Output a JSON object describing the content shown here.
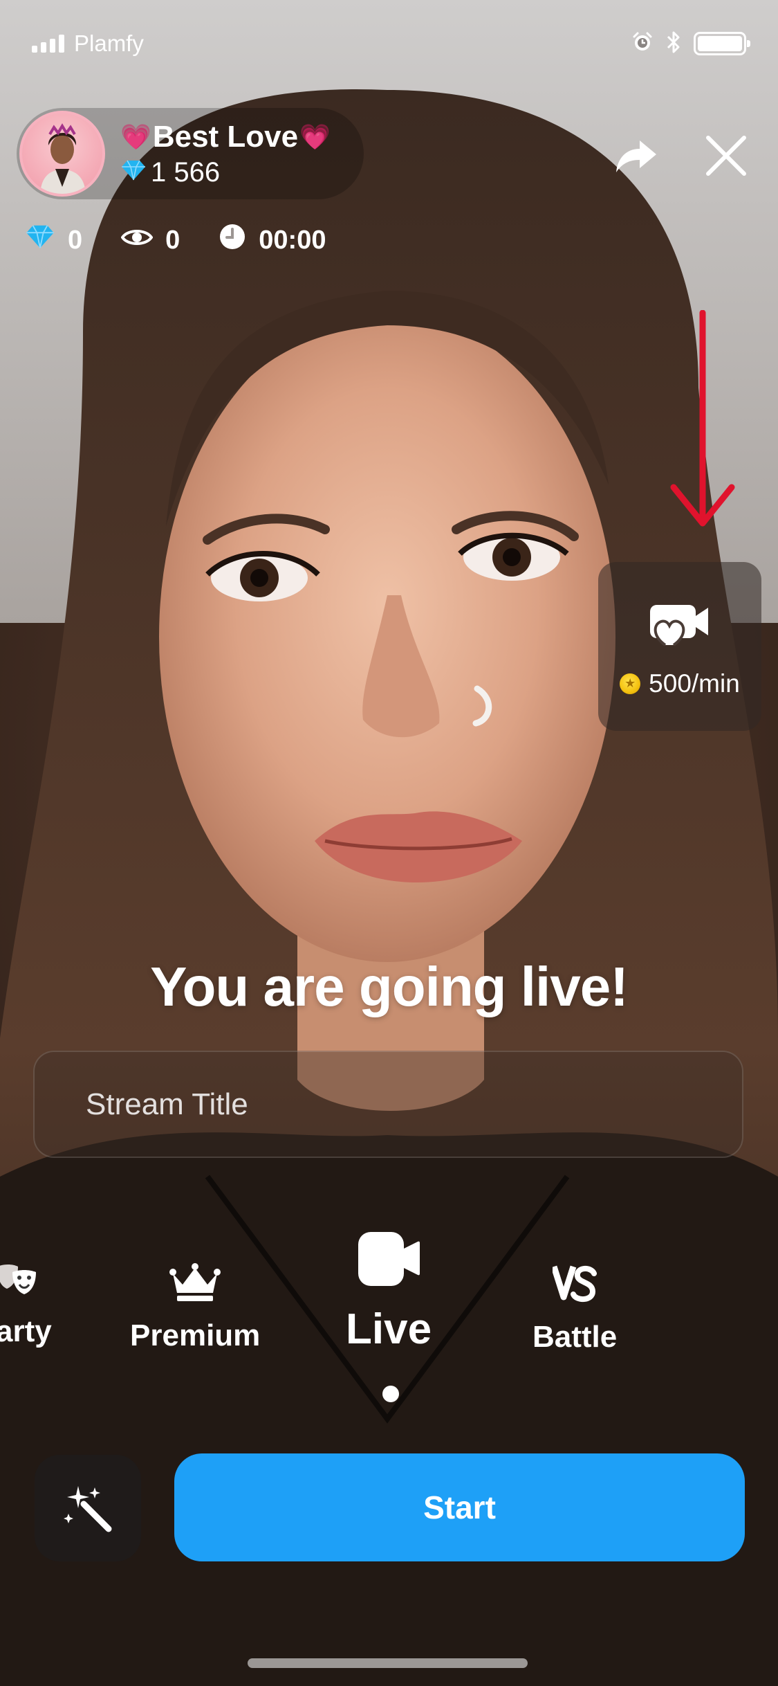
{
  "status_bar": {
    "carrier": "Plamfy",
    "icons": [
      "signal-icon",
      "alarm-icon",
      "bluetooth-icon",
      "battery-icon"
    ]
  },
  "host": {
    "name": "Best Love",
    "name_emoji": "💗",
    "diamonds": "1 566"
  },
  "stats": {
    "diamonds": "0",
    "viewers": "0",
    "duration": "00:00"
  },
  "video_card": {
    "price": "500/min",
    "icon": "video-call-icon"
  },
  "headline": "You are going live!",
  "stream_title": {
    "placeholder": "Stream Title",
    "value": ""
  },
  "modes": [
    {
      "label": "arty",
      "icon": "party-masks-icon"
    },
    {
      "label": "Premium",
      "icon": "crown-icon"
    },
    {
      "label": "Live",
      "icon": "camera-icon",
      "active": true
    },
    {
      "label": "Battle",
      "icon": "vs-icon"
    }
  ],
  "start_button": "Start",
  "colors": {
    "accent": "#1ea0f7",
    "annotation": "#e0132d",
    "diamond": "#22b4f0",
    "coin": "#f4c10f"
  }
}
